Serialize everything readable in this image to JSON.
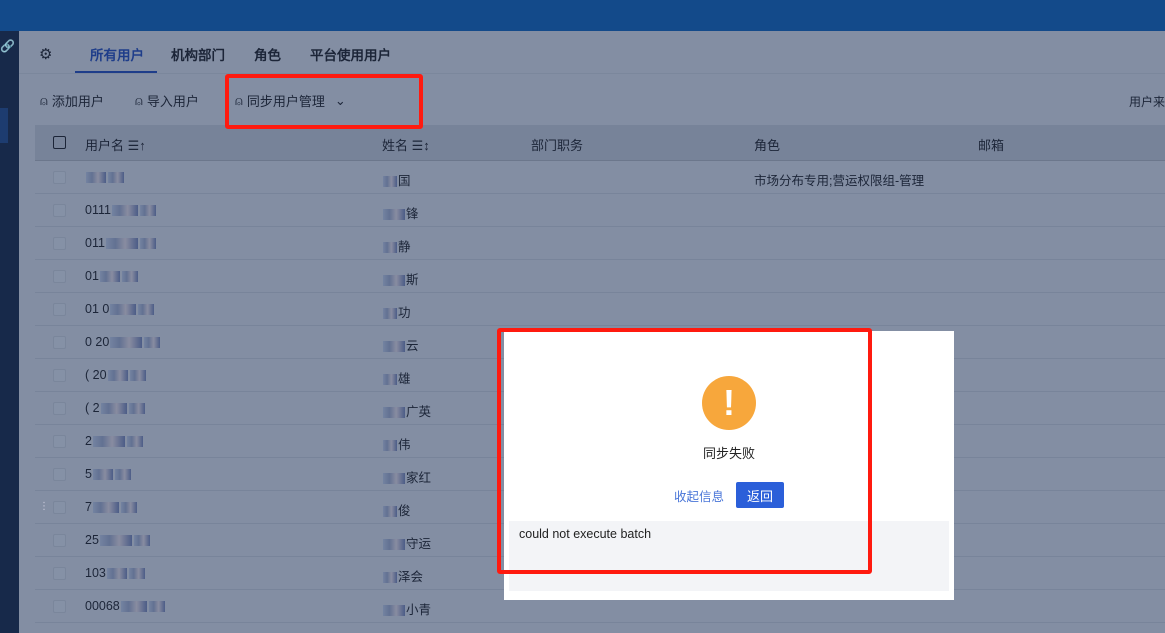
{
  "tabs": [
    "所有用户",
    "机构部门",
    "角色",
    "平台使用用户"
  ],
  "toolbar": {
    "add": "添加用户",
    "import": "导入用户",
    "sync": "同步用户管理",
    "source": "用户来"
  },
  "columns": {
    "username": "用户名",
    "name": "姓名",
    "dept": "部门职务",
    "role": "角色",
    "email": "邮箱"
  },
  "rows": [
    {
      "username": "",
      "name": "国",
      "role": "市场分布专用;营运权限组-管理"
    },
    {
      "username": "0111",
      "name": "锋",
      "role": ""
    },
    {
      "username": "011",
      "name": "静",
      "role": ""
    },
    {
      "username": "01",
      "name": "斯",
      "role": ""
    },
    {
      "username": "01  0",
      "name": "功",
      "role": ""
    },
    {
      "username": "0  20",
      "name": "云",
      "role": ""
    },
    {
      "username": "(  20",
      "name": "雄",
      "role": ""
    },
    {
      "username": "(  2",
      "name": "广英",
      "role": ""
    },
    {
      "username": "  2",
      "name": "伟",
      "role": ""
    },
    {
      "username": "  5",
      "name": "家红",
      "role": ""
    },
    {
      "username": "  7",
      "name": "俊",
      "role": ""
    },
    {
      "username": "  25",
      "name": "守运",
      "role": ""
    },
    {
      "username": "  103",
      "name": "泽会",
      "role": ""
    },
    {
      "username": "  00068",
      "name": "小青",
      "role": ""
    }
  ],
  "dialog": {
    "title": "同步失败",
    "collapse": "收起信息",
    "back": "返回",
    "detail": "could not execute batch"
  }
}
